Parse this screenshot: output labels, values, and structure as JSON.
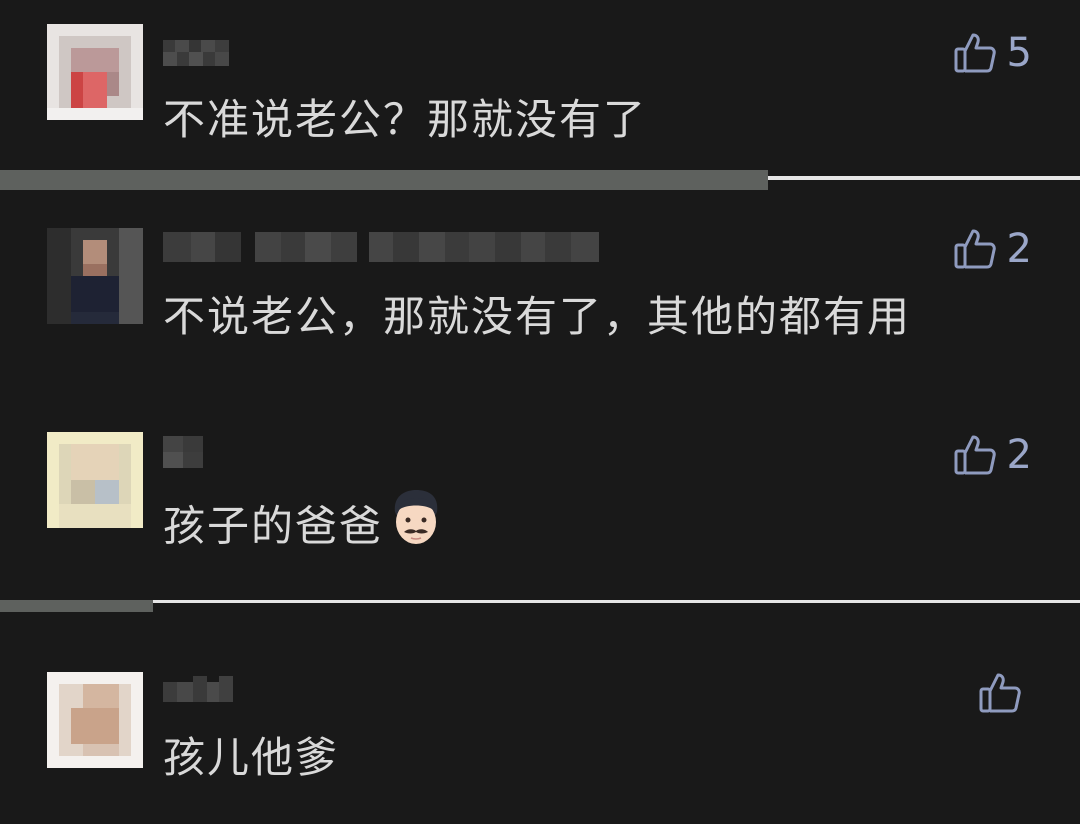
{
  "comments": [
    {
      "text": "不准说老公？那就没有了",
      "like_count": "5",
      "has_emoji": false
    },
    {
      "text": "不说老公，那就没有了，其他的都有用",
      "like_count": "2",
      "has_emoji": false
    },
    {
      "text": "孩子的爸爸",
      "like_count": "2",
      "has_emoji": true,
      "emoji_name": "man-with-mustache-emoji"
    },
    {
      "text": "孩儿他爹",
      "like_count": "",
      "has_emoji": false
    }
  ],
  "colors": {
    "background": "#191919",
    "text": "#d9d9d9",
    "like_icon": "#8f9bbf",
    "divider_light": "#e6e6e6",
    "divider_gray": "#5e615e"
  }
}
